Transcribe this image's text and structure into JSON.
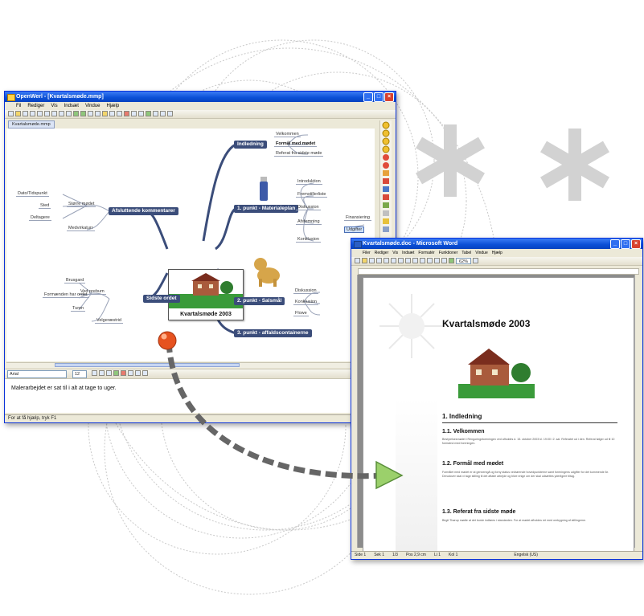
{
  "mindmap_window": {
    "title": "OpenWerl - [Kvartalsmøde.mmp]",
    "menu": [
      "Fil",
      "Rediger",
      "Vis",
      "Indsæt",
      "Vindue",
      "Hjælp"
    ],
    "font_name": "Arial",
    "font_size": "12",
    "tab_label": "Kvartalsmøde.mmp",
    "central_topic": "Kvartalsmøde 2003",
    "branches": [
      {
        "label": "Indledning",
        "subtopics": [
          "Velkommen",
          "Formål med mødet",
          "Referat fra sidste møde"
        ]
      },
      {
        "label": "1. punkt - Materialeplan",
        "subtopics": [
          "Introduktion",
          "Fremstillerliste",
          "Diskussion",
          "Afstemning",
          "Konklusion"
        ],
        "extra": [
          "Finansiering",
          "Udgifter"
        ]
      },
      {
        "label": "2. punkt - Salsmål",
        "subtopics": [
          "Diskussion",
          "Konklusion",
          "Flowe"
        ]
      },
      {
        "label": "3. punkt - affaldscontainerne",
        "subtopics": []
      },
      {
        "label": "Afsluttende kommentarer",
        "subtopics": [
          "Større mødet",
          "Medvirkaturr"
        ],
        "leafs": [
          "Dato/Tidspunkt",
          "Sted",
          "Deltagere"
        ]
      },
      {
        "label": "Sidste ordet",
        "subtopics": [
          "Ved prebum",
          "Velgeræstrid"
        ],
        "leafs": [
          "Brusgard",
          "Formænden har ordet",
          "Turen"
        ]
      }
    ],
    "note_text": "Malerarbejdet er sat til i alt at tage to uger.",
    "status": "For at få hjælp, tryk F1"
  },
  "word_window": {
    "title": "Kvartalsmøde.doc - Microsoft Word",
    "menu": [
      "Filer",
      "Rediger",
      "Vis",
      "Indsæt",
      "Formatér",
      "Funktioner",
      "Tabel",
      "Vindue",
      "Hjælp"
    ],
    "zoom": "62%",
    "doc_title": "Kvartalsmøde 2003",
    "sections": [
      {
        "heading": "1. Indledning"
      },
      {
        "heading": "1.1. Velkommen",
        "text": "Bestyrelsesmødet i Rengoringsforeningen ved afholdes d. 15. oktober 2003 kl. 19:00 i 2. sal. Referatet ud i den. Referat følger ud til 10 formænd med foreningen."
      },
      {
        "heading": "1.2. Formål med mødet",
        "text": "Formålet med mødet er at gennemgå og forny status vedrørende hovedpunkterne samt foreningens udgifter for det kommende år. Derudover skal vi tage stilling til det aftalte arbejde og blive enige om der skal udsættes yderligere tiltag."
      },
      {
        "heading": "1.3. Referat fra sidste møde",
        "text": "Birgit Thørup mødte at det burde indføres i standarden. For at mødet afholdes ret med ombygning af stillingerne."
      }
    ],
    "status": [
      "Side 1",
      "Sek 1",
      "1/3",
      "Pos 2,9 cm",
      "Li 1",
      "Kol 1",
      "Engelsk (US)"
    ]
  }
}
